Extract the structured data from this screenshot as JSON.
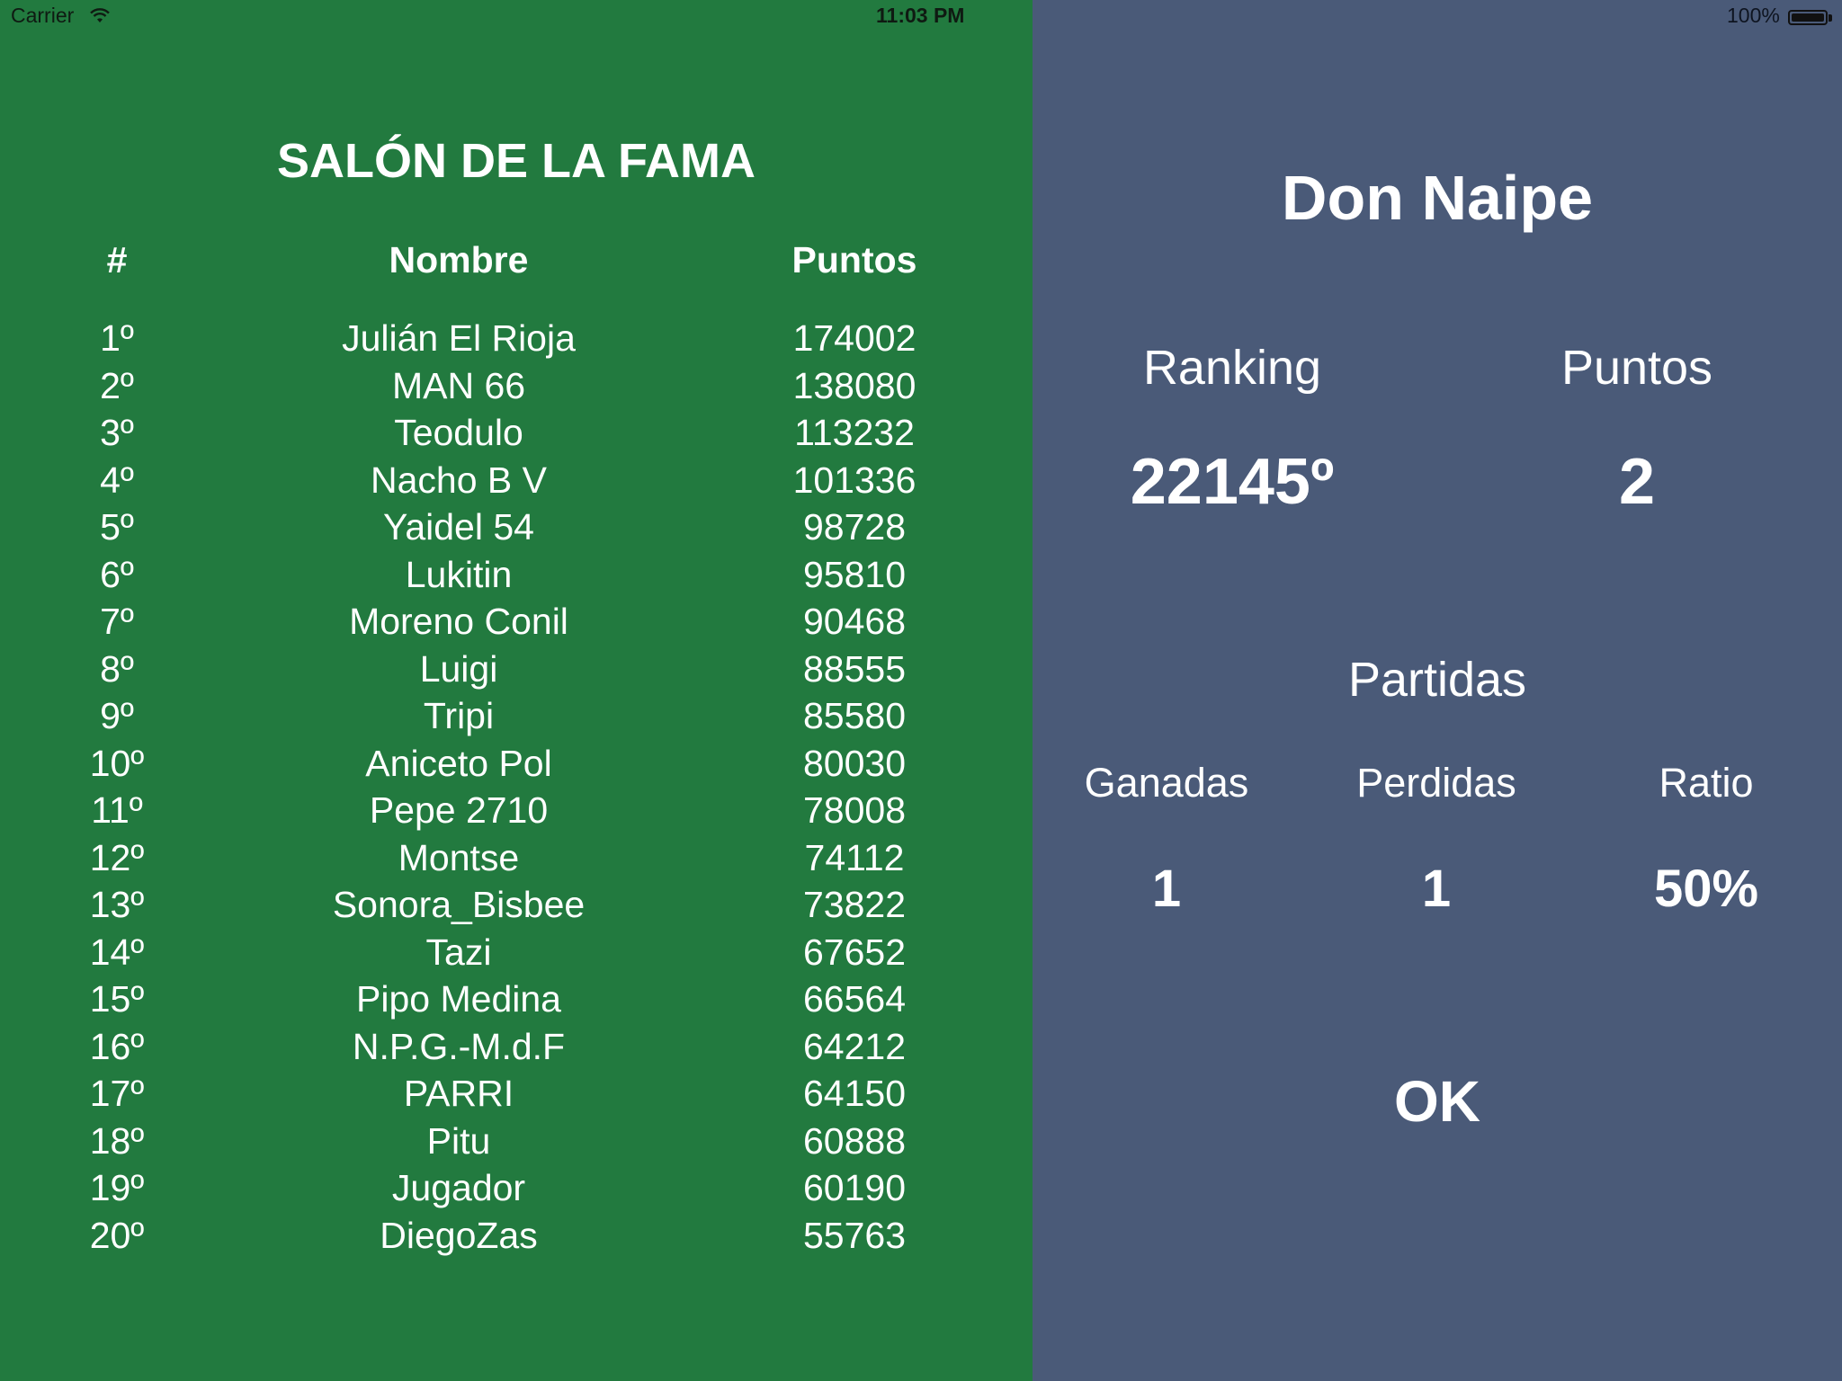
{
  "status_bar": {
    "carrier": "Carrier",
    "time": "11:03 PM",
    "battery": "100%",
    "wifi_icon": "wifi-icon",
    "battery_icon": "battery-icon"
  },
  "colors": {
    "left_bg": "#227a3f",
    "right_bg": "#4a5a78",
    "text": "#ffffff"
  },
  "hall_of_fame": {
    "title": "SALÓN DE LA FAMA",
    "headers": {
      "rank": "#",
      "name": "Nombre",
      "points": "Puntos"
    },
    "rows": [
      {
        "rank": "1º",
        "name": "Julián El Rioja",
        "points": "174002"
      },
      {
        "rank": "2º",
        "name": "MAN 66",
        "points": "138080"
      },
      {
        "rank": "3º",
        "name": "Teodulo",
        "points": "113232"
      },
      {
        "rank": "4º",
        "name": "Nacho B V",
        "points": "101336"
      },
      {
        "rank": "5º",
        "name": "Yaidel 54",
        "points": "98728"
      },
      {
        "rank": "6º",
        "name": "Lukitin",
        "points": "95810"
      },
      {
        "rank": "7º",
        "name": "Moreno Conil",
        "points": "90468"
      },
      {
        "rank": "8º",
        "name": "Luigi",
        "points": "88555"
      },
      {
        "rank": "9º",
        "name": "Tripi",
        "points": "85580"
      },
      {
        "rank": "10º",
        "name": "Aniceto Pol",
        "points": "80030"
      },
      {
        "rank": "11º",
        "name": "Pepe 2710",
        "points": "78008"
      },
      {
        "rank": "12º",
        "name": "Montse",
        "points": "74112"
      },
      {
        "rank": "13º",
        "name": "Sonora_Bisbee",
        "points": "73822"
      },
      {
        "rank": "14º",
        "name": "Tazi",
        "points": "67652"
      },
      {
        "rank": "15º",
        "name": "Pipo Medina",
        "points": "66564"
      },
      {
        "rank": "16º",
        "name": "N.P.G.-M.d.F",
        "points": "64212"
      },
      {
        "rank": "17º",
        "name": "PARRI",
        "points": "64150"
      },
      {
        "rank": "18º",
        "name": "Pitu",
        "points": "60888"
      },
      {
        "rank": "19º",
        "name": "Jugador",
        "points": "60190"
      },
      {
        "rank": "20º",
        "name": "DiegoZas",
        "points": "55763"
      }
    ]
  },
  "player": {
    "name": "Don Naipe",
    "ranking_label": "Ranking",
    "ranking_value": "22145º",
    "points_label": "Puntos",
    "points_value": "2",
    "games_label": "Partidas",
    "won_label": "Ganadas",
    "won_value": "1",
    "lost_label": "Perdidas",
    "lost_value": "1",
    "ratio_label": "Ratio",
    "ratio_value": "50%"
  },
  "actions": {
    "ok_label": "OK"
  }
}
